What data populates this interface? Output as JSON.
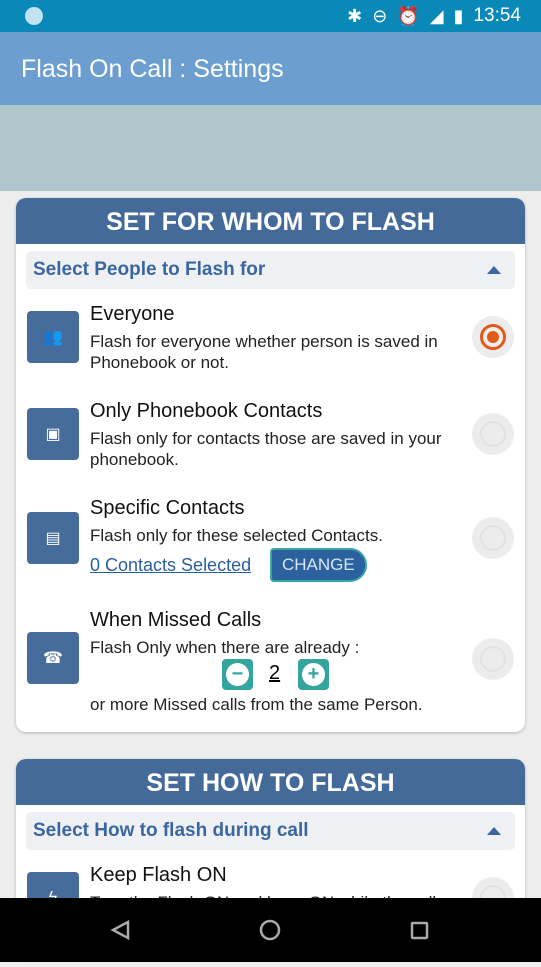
{
  "status_bar": {
    "time": "13:54",
    "icons": [
      "bluetooth-icon",
      "do-not-disturb-icon",
      "alarm-icon",
      "signal-icon",
      "battery-charging-icon"
    ]
  },
  "app_bar": {
    "title": "Flash On Call : Settings"
  },
  "card_whom": {
    "header": "SET FOR WHOM TO FLASH",
    "section": "Select People to Flash for",
    "options": [
      {
        "title": "Everyone",
        "desc": "Flash for everyone whether person is saved in Phonebook or not.",
        "selected": true,
        "icon": "people-icon"
      },
      {
        "title": "Only Phonebook Contacts",
        "desc": "Flash only for contacts those are saved in your phonebook.",
        "selected": false,
        "icon": "contact-book-icon"
      },
      {
        "title": "Specific Contacts",
        "desc": "Flash only for these selected Contacts.",
        "selected": false,
        "icon": "contact-calendar-icon",
        "link": "0 Contacts Selected",
        "button": "CHANGE"
      },
      {
        "title": "When Missed Calls",
        "desc": "Flash Only when there are already :",
        "desc2": "or more Missed calls from the same Person.",
        "selected": false,
        "icon": "missed-call-icon",
        "count": "2",
        "minus": "−",
        "plus": "+"
      }
    ]
  },
  "card_how": {
    "header": "SET HOW TO FLASH",
    "section": "Select How to flash during call",
    "options": [
      {
        "title": "Keep Flash ON",
        "desc": "Turn the Flash ON and keep ON while the call",
        "selected": false,
        "icon": "flash-icon"
      }
    ]
  },
  "colors": {
    "status_bar": "#0a89b9",
    "app_bar": "#6c9ecf",
    "card_header": "#436a99",
    "accent_radio": "#e05a1a",
    "stepper": "#33a59f"
  }
}
